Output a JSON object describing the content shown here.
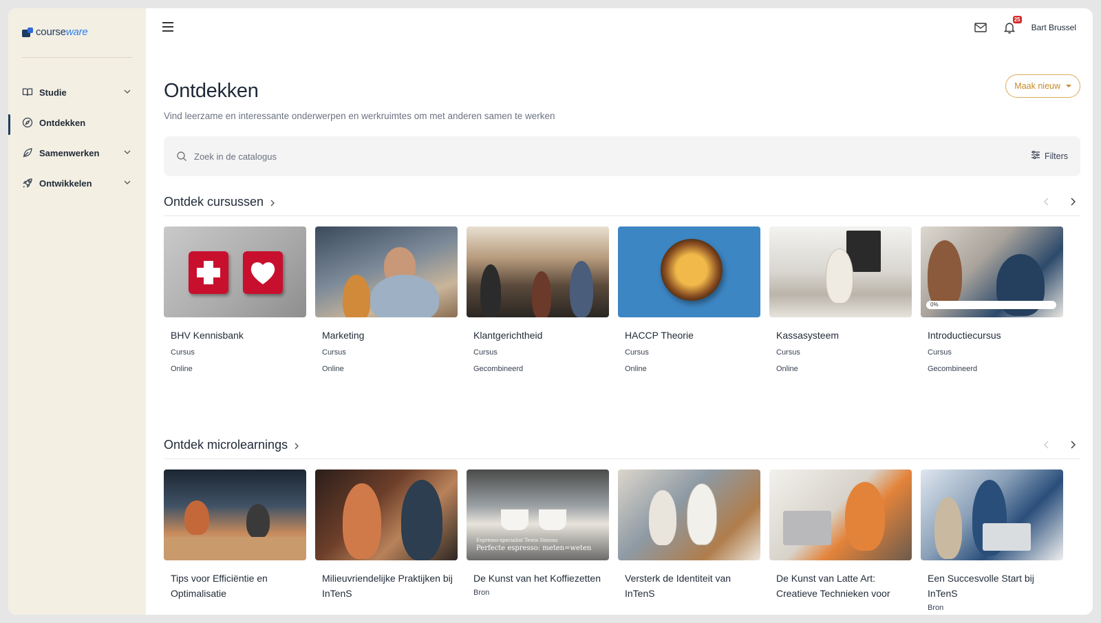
{
  "app": {
    "logo_prefix": "course",
    "logo_suffix": "ware"
  },
  "sidebar": {
    "items": [
      {
        "label": "Studie",
        "icon": "book-icon",
        "has_children": true
      },
      {
        "label": "Ontdekken",
        "icon": "compass-icon",
        "active": true
      },
      {
        "label": "Samenwerken",
        "icon": "leaf-icon",
        "has_children": true
      },
      {
        "label": "Ontwikkelen",
        "icon": "rocket-icon",
        "has_children": true
      }
    ]
  },
  "topbar": {
    "notification_count": "25",
    "user_name": "Bart Brussel"
  },
  "page": {
    "title": "Ontdekken",
    "subtitle": "Vind leerzame en interessante onderwerpen en werkruimtes om met anderen samen te werken",
    "make_new_label": "Maak nieuw"
  },
  "search": {
    "placeholder": "Zoek in de catalogus",
    "filters_label": "Filters"
  },
  "courses": {
    "title": "Ontdek cursussen",
    "items": [
      {
        "title": "BHV Kennisbank",
        "type": "Cursus",
        "mode": "Online"
      },
      {
        "title": "Marketing",
        "type": "Cursus",
        "mode": "Online"
      },
      {
        "title": "Klantgerichtheid",
        "type": "Cursus",
        "mode": "Gecombineerd"
      },
      {
        "title": "HACCP Theorie",
        "type": "Cursus",
        "mode": "Online"
      },
      {
        "title": "Kassasysteem",
        "type": "Cursus",
        "mode": "Online"
      },
      {
        "title": "Introductiecursus",
        "type": "Cursus",
        "mode": "Gecombineerd",
        "progress": "0%"
      }
    ]
  },
  "microlearnings": {
    "title": "Ontdek microlearnings",
    "items": [
      {
        "title": "Tips voor Efficiëntie en Optimalisatie"
      },
      {
        "title": "Milieuvriendelijke Praktijken bij InTenS"
      },
      {
        "title": "De Kunst van het Koffiezetten",
        "type": "Bron",
        "caption_small": "Espresso-specialist Tewis Simons",
        "caption_large": "Perfecte espresso: meten=weten"
      },
      {
        "title": "Versterk de Identiteit van InTenS"
      },
      {
        "title": "De Kunst van Latte Art: Creatieve Technieken voor"
      },
      {
        "title": "Een Succesvolle Start bij InTenS",
        "type": "Bron"
      }
    ]
  }
}
